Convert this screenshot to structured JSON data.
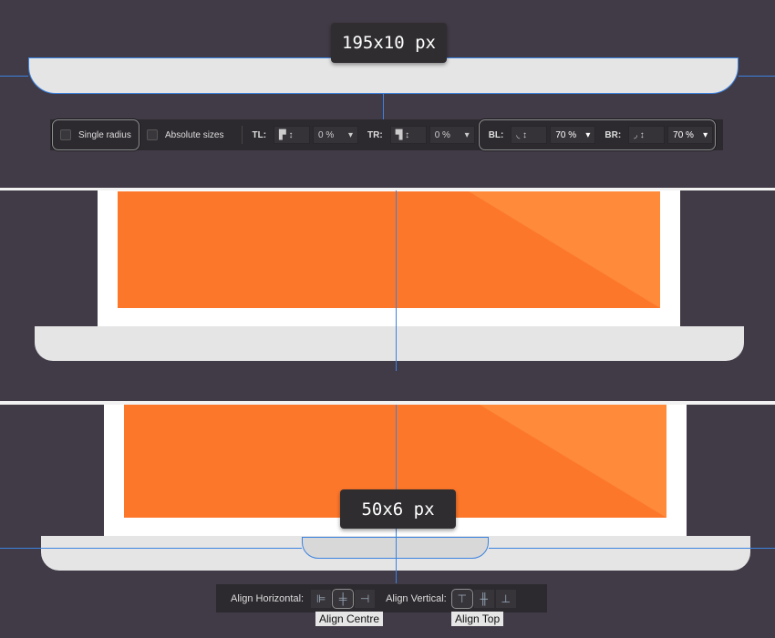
{
  "panel1": {
    "dimension_tooltip": "195x10 px",
    "toolbar": {
      "single_radius": "Single radius",
      "absolute_sizes": "Absolute sizes",
      "tl_label": "TL:",
      "tl_value": "0 %",
      "tr_label": "TR:",
      "tr_value": "0 %",
      "bl_label": "BL:",
      "bl_value": "70 %",
      "br_label": "BR:",
      "br_value": "70 %"
    }
  },
  "panel3": {
    "dimension_tooltip": "50x6 px",
    "toolbar": {
      "align_horizontal": "Align Horizontal:",
      "align_vertical": "Align Vertical:"
    },
    "tooltip_centre": "Align Centre",
    "tooltip_top": "Align Top"
  },
  "colors": {
    "background": "#413b47",
    "orange": "#fd772b",
    "guide": "#3b82e0",
    "shape": "#e5e5e5"
  }
}
